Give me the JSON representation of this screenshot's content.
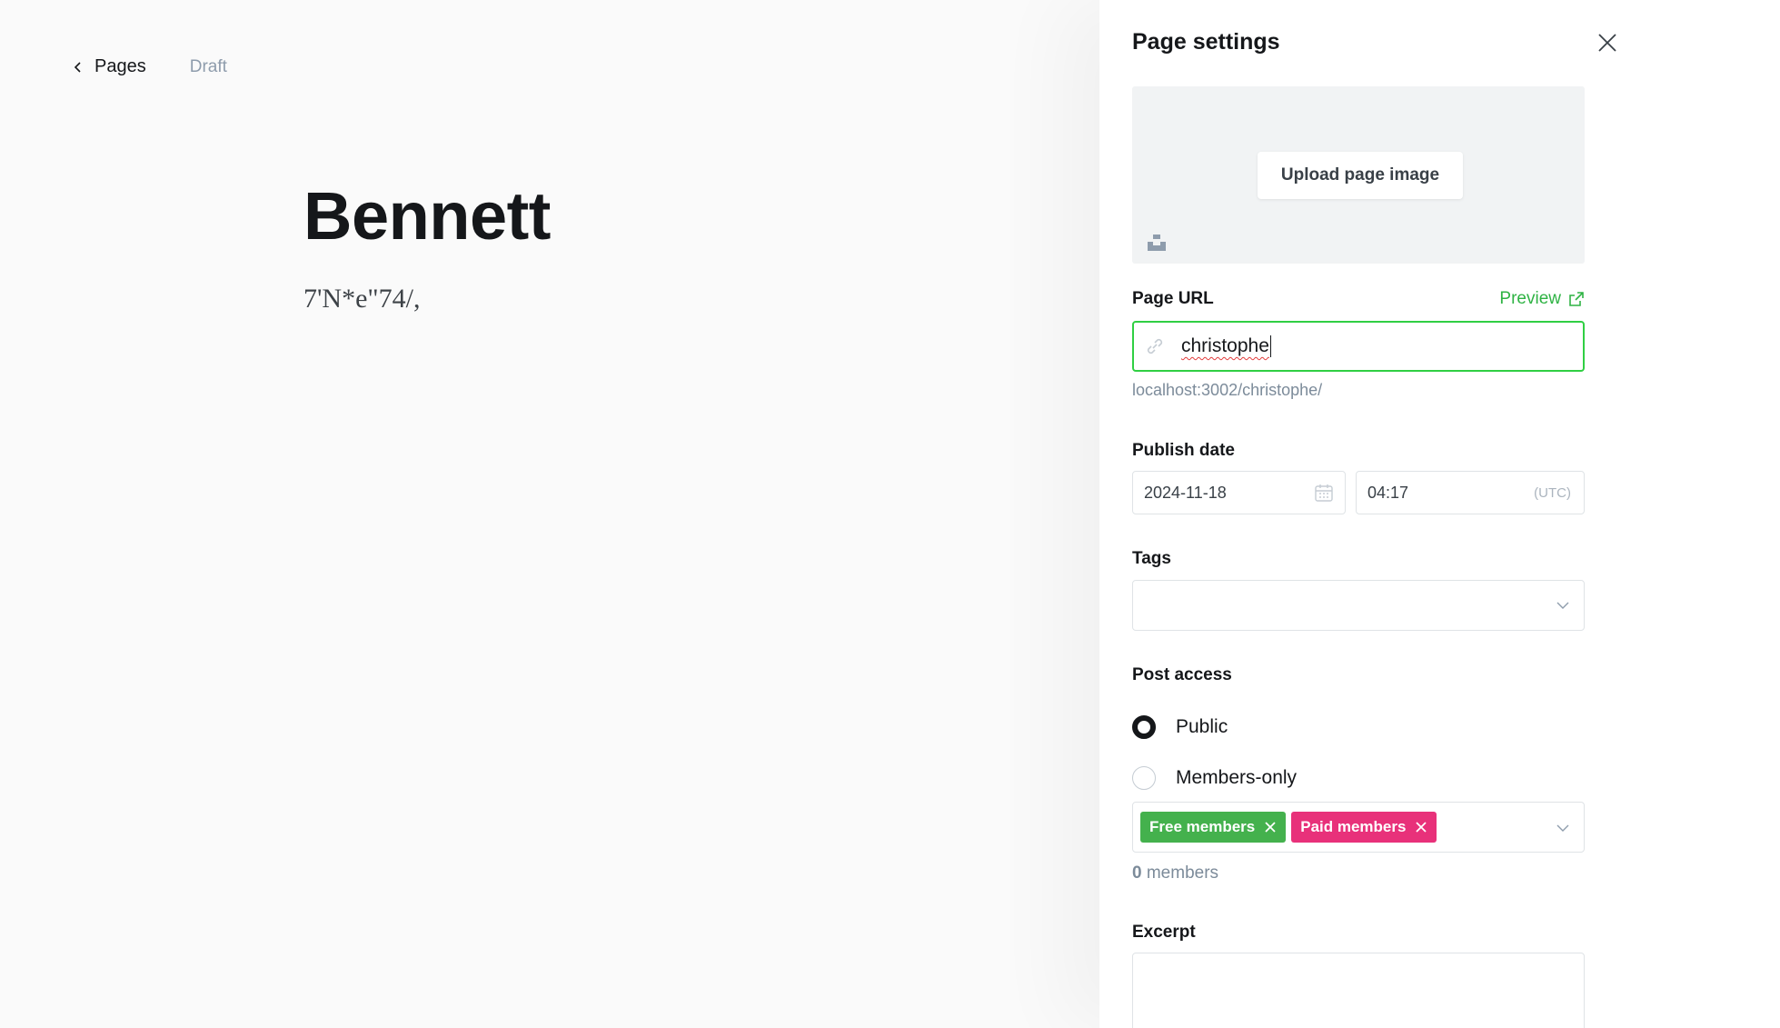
{
  "editor": {
    "back_label": "Pages",
    "status": "Draft",
    "title": "Bennett",
    "body_text": "7'N*e\"74/,"
  },
  "settings": {
    "title": "Page settings",
    "upload_label": "Upload page image",
    "page_url_label": "Page URL",
    "preview_label": "Preview",
    "slug_value": "christophe",
    "url_hint": "localhost:3002/christophe/",
    "publish_date_label": "Publish date",
    "date_value": "2024-11-18",
    "time_value": "04:17",
    "timezone": "(UTC)",
    "tags_label": "Tags",
    "post_access_label": "Post access",
    "access_options": [
      {
        "label": "Public",
        "selected": true
      },
      {
        "label": "Members-only",
        "selected": false
      }
    ],
    "member_tiers": [
      {
        "label": "Free members",
        "color": "#44b14d"
      },
      {
        "label": "Paid members",
        "color": "#e8317a"
      }
    ],
    "members_count": "0",
    "members_suffix": "members",
    "excerpt_label": "Excerpt"
  },
  "colors": {
    "accent_green": "#30cf43",
    "preview_green": "#2fb344"
  }
}
